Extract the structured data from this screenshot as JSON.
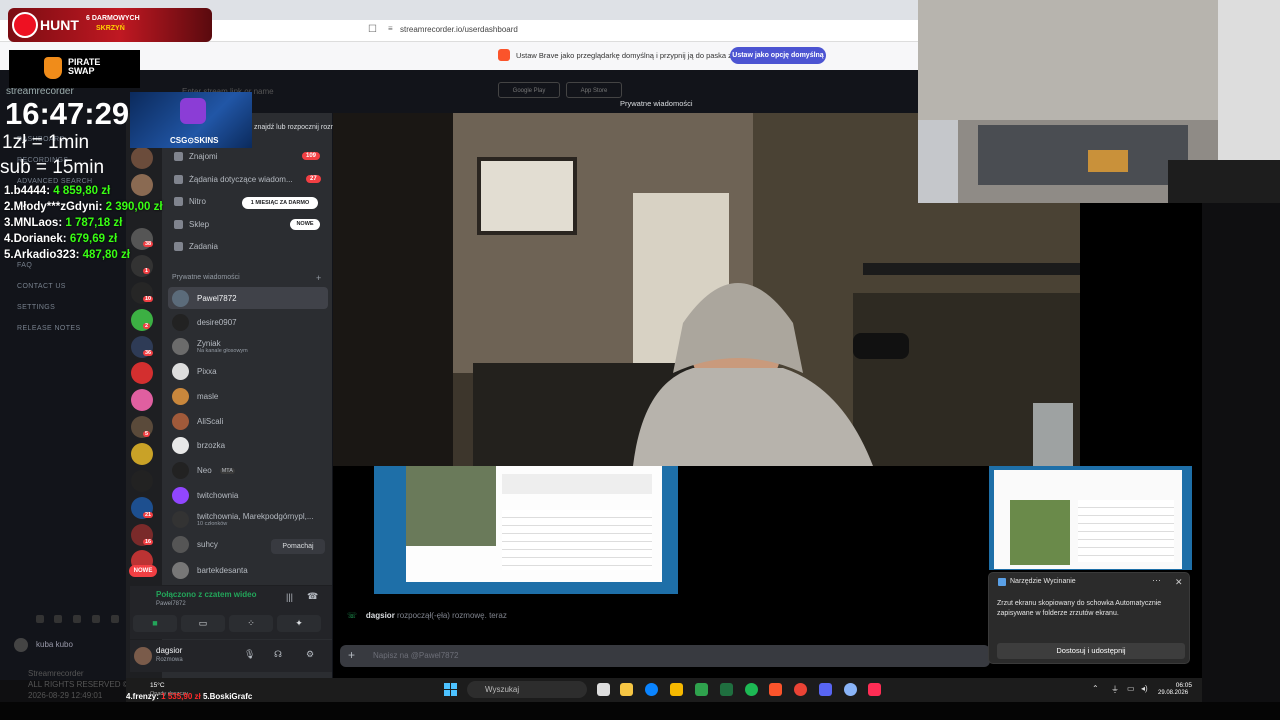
{
  "browser": {
    "url": "streamrecorder.io/userdashboard",
    "brave_prompt": "Ustaw Brave jako przeglądarkę domyślną i przypnij ją do paska zadań",
    "brave_button": "Ustaw jako opcję domyślną"
  },
  "streamrecorder": {
    "logo": "streamrecorder",
    "search_placeholder": "Enter stream link or name",
    "store_google": "Google Play",
    "store_apple": "App Store",
    "nav": [
      "DASHBOARD",
      "RECORDINGS",
      "ADVANCED SEARCH",
      "FAQ",
      "CONTACT US",
      "SETTINGS",
      "RELEASE NOTES"
    ],
    "user": "kuba kubo",
    "footer": [
      "Streamrecorder",
      "ALL RIGHTS RESERVED ©",
      "2026-08-29 12:49:01"
    ]
  },
  "discord": {
    "find_convo": "znajdź lub rozpocznij rozmowę",
    "menu": [
      {
        "label": "Znajomi",
        "badge": "109"
      },
      {
        "label": "Żądania dotyczące wiadom...",
        "badge": "27"
      },
      {
        "label": "Nitro",
        "pill": "1 MIESIĄC ZA DARMO"
      },
      {
        "label": "Sklep",
        "pill": "NOWE"
      },
      {
        "label": "Zadania"
      }
    ],
    "dm_header": "Prywatne wiadomości",
    "dms": [
      {
        "name": "Pawel7872",
        "sub": "",
        "color": "#5b6b7a"
      },
      {
        "name": "desire0907",
        "sub": "",
        "color": "#222"
      },
      {
        "name": "Zyniak",
        "sub": "Na kanale głosowym",
        "color": "#6b6b6b"
      },
      {
        "name": "Pixxa",
        "sub": "",
        "color": "#ddd"
      },
      {
        "name": "masle",
        "sub": "",
        "color": "#c9873c"
      },
      {
        "name": "AliScali",
        "sub": "",
        "color": "#a05a3a"
      },
      {
        "name": "brzozka",
        "sub": "",
        "color": "#e8e8e8"
      },
      {
        "name": "Neo",
        "sub": "",
        "color": "#222"
      },
      {
        "name": "twitchownia",
        "sub": "",
        "color": "#9146ff"
      },
      {
        "name": "twitchownia, Marekpodgórnypl,...",
        "sub": "10 członków",
        "color": "#333"
      },
      {
        "name": "suhcy",
        "sub": "",
        "color": "#555"
      },
      {
        "name": "bartekdesanta",
        "sub": "",
        "color": "#777"
      }
    ],
    "neo_tag": "MTA",
    "wave_button": "Pomachaj",
    "server_badges": [
      "2",
      "38",
      "1",
      "10",
      "2",
      "36",
      "5",
      "21",
      "16"
    ],
    "new_badge": "NOWE",
    "voice_status": "Połączono z czatem wideo",
    "voice_sub": "Pawel7872",
    "user_name": "dagsior",
    "user_status": "Rozmowa",
    "call_title": "Prywatne wiadomości",
    "chat_user": "dagsior",
    "chat_text": "rozpoczął(-ęła) rozmowę. teraz",
    "chat_placeholder": "Napisz na @Pawel7872"
  },
  "snip_toast": {
    "title": "Narzędzie Wycinanie",
    "body": "Zrzut ekranu skopiowany do schowka Automatycznie zapisywane w folderze zrzutów ekranu.",
    "button": "Dostosuj i udostępnij"
  },
  "taskbar": {
    "weather_temp": "15°C",
    "weather_desc": "Opady deszczu",
    "search": "Wyszukaj",
    "time": "06:05",
    "date": "29.08.2026",
    "app_colors": [
      "#eee",
      "#f6c644",
      "#0a84ff",
      "#f5b800",
      "#1db954",
      "#2fa24d",
      "#fb542b",
      "#ea4335",
      "#5865f2",
      "#8ab4f8",
      "#ff2d55"
    ]
  },
  "overlay": {
    "hunt": "HUNT",
    "hunt_sub1": "6 DARMOWYCH",
    "hunt_sub2": "SKRZYŃ",
    "pirate": "PIRATE SWAP",
    "clock": "16:47:29",
    "rate1": "1zł = 1min",
    "rate2": "sub = 15min",
    "leaderboard": [
      {
        "name": "1.b4444:",
        "amount": "4 859,80 zł"
      },
      {
        "name": "2.Młody***zGdyni:",
        "amount": "2 390,00 zł"
      },
      {
        "name": "3.MNLaos:",
        "amount": "1 787,18 zł"
      },
      {
        "name": "4.Dorianek:",
        "amount": "679,69 zł"
      },
      {
        "name": "5.Arkadio323:",
        "amount": "487,80 zł"
      }
    ],
    "csgo": "CSG⊙SKINS",
    "ticker_a": "4.frenzy:",
    "ticker_a_amt": "1 535,90 zł",
    "ticker_b": "5.BoskiGrafc"
  }
}
